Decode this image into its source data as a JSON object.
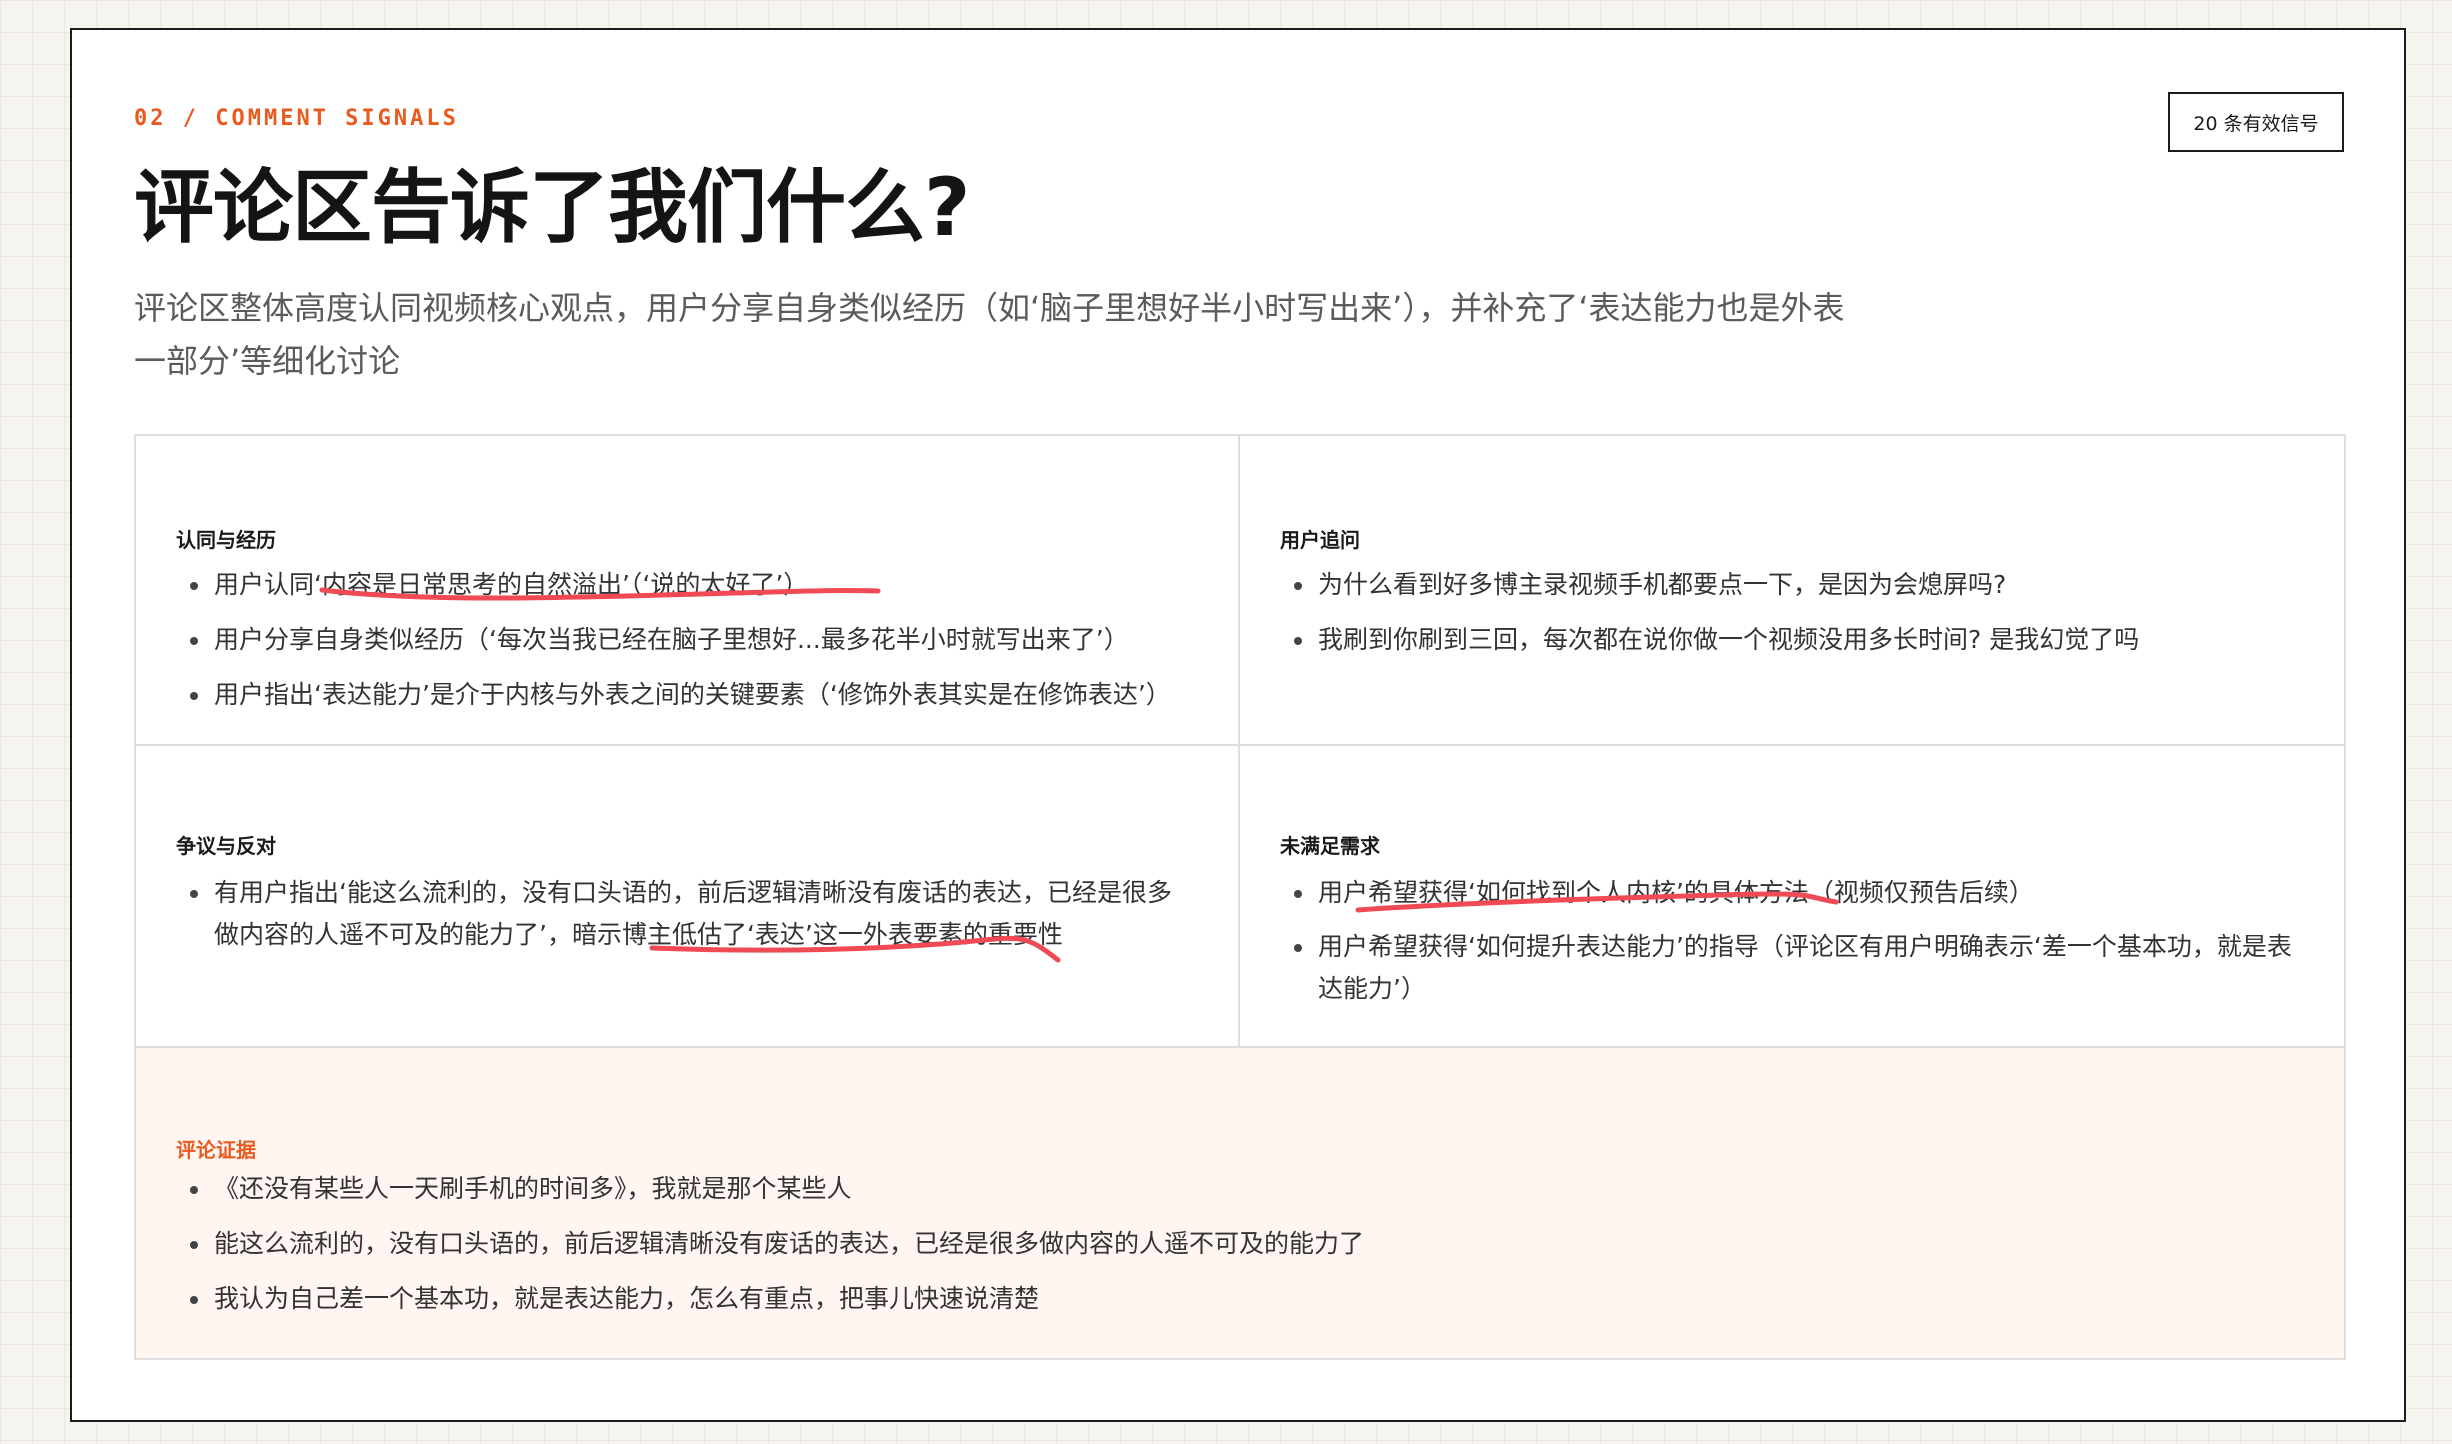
{
  "header": {
    "kicker": "02 / COMMENT SIGNALS",
    "badge": "20 条有效信号",
    "title": "评论区告诉了我们什么?",
    "subtitle": "评论区整体高度认同视频核心观点，用户分享自身类似经历（如‘脑子里想好半小时写出来’），并补充了‘表达能力也是外表一部分’等细化讨论"
  },
  "cards": [
    {
      "title": "认同与经历",
      "items": [
        "用户认同‘内容是日常思考的自然溢出’（‘说的太好了’）",
        "用户分享自身类似经历（‘每次当我已经在脑子里想好...最多花半小时就写出来了’）",
        "用户指出‘表达能力’是介于内核与外表之间的关键要素（‘修饰外表其实是在修饰表达’）"
      ]
    },
    {
      "title": "用户追问",
      "items": [
        "为什么看到好多博主录视频手机都要点一下，是因为会熄屏吗?",
        "我刷到你刷到三回，每次都在说你做一个视频没用多长时间? 是我幻觉了吗"
      ]
    },
    {
      "title": "争议与反对",
      "items": [
        "有用户指出‘能这么流利的，没有口头语的，前后逻辑清晰没有废话的表达，已经是很多做内容的人遥不可及的能力了’，暗示博主低估了‘表达’这一外表要素的重要性"
      ]
    },
    {
      "title": "未满足需求",
      "items": [
        "用户希望获得‘如何找到个人内核’的具体方法（视频仅预告后续）",
        "用户希望获得‘如何提升表达能力’的指导（评论区有用户明确表示‘差一个基本功，就是表达能力’）"
      ]
    },
    {
      "title": "评论证据",
      "items": [
        "《还没有某些人一天刷手机的时间多》，我就是那个某些人",
        "能这么流利的，没有口头语的，前后逻辑清晰没有废话的表达，已经是很多做内容的人遥不可及的能力了",
        "我认为自己差一个基本功，就是表达能力，怎么有重点，把事儿快速说清楚"
      ]
    }
  ],
  "colors": {
    "accent": "#ea5a1e",
    "annotation": "#f04a55",
    "evidence_bg": "#fff6f2"
  }
}
